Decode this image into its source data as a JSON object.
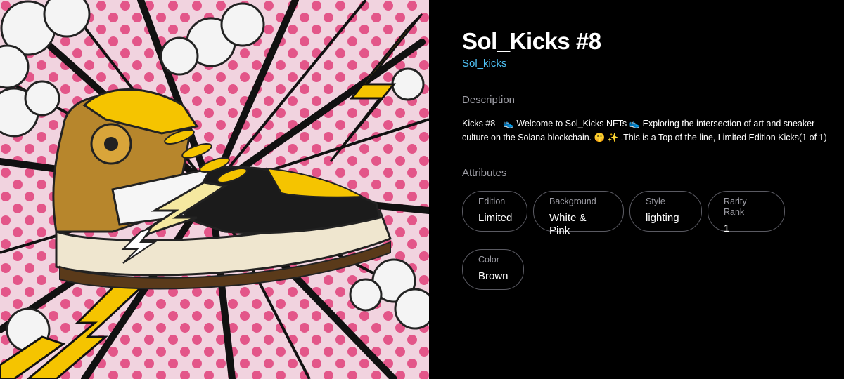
{
  "nft": {
    "title": "Sol_Kicks #8",
    "collection": "Sol_kicks",
    "image_alt": "Comic pop-art illustration of a yellow, brown and black high-top sneaker with lightning bolts"
  },
  "sections": {
    "description_label": "Description",
    "attributes_label": "Attributes"
  },
  "description": "Kicks #8 - 👟 Welcome to Sol_Kicks NFTs 👟 Exploring the intersection of art and sneaker culture on the Solana blockchain. 🤫 ✨ .This is a Top of the line, Limited Edition Kicks(1 of 1)",
  "attributes": [
    {
      "trait": "Edition",
      "value": "Limited"
    },
    {
      "trait": "Background",
      "value": "White & Pink"
    },
    {
      "trait": "Style",
      "value": "lighting"
    },
    {
      "trait": "Rarity Rank",
      "value": "1"
    },
    {
      "trait": "Color",
      "value": "Brown"
    }
  ],
  "colors": {
    "background": "#000000",
    "link": "#4fc3f7",
    "muted": "#9e9ea6",
    "chip_border": "#5a5a62",
    "art_pink": "#e0407a",
    "art_yellow": "#f5c400"
  }
}
